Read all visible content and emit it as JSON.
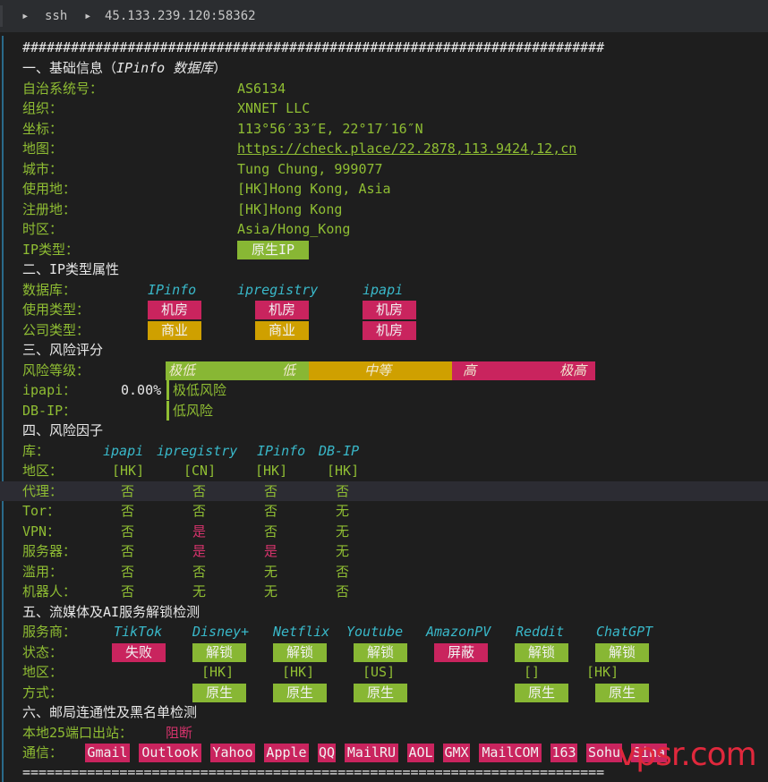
{
  "titlebar": {
    "arrow": "▸",
    "tab": "ssh",
    "host": "45.133.239.120:58362"
  },
  "hashline": "########################################################################",
  "s1": {
    "title": "一、基础信息（",
    "title_italic": "IPinfo 数据库",
    "title_end": "）",
    "rows": [
      {
        "label": "自治系统号：",
        "value": "AS6134"
      },
      {
        "label": "组织：",
        "value": "XNNET LLC"
      },
      {
        "label": "坐标：",
        "value": "113°56′33″E, 22°17′16″N"
      },
      {
        "label": "地图：",
        "value": "https://check.place/22.2878,113.9424,12,cn"
      },
      {
        "label": "城市：",
        "value": "Tung Chung, 999077"
      },
      {
        "label": "使用地：",
        "value": "[HK]Hong Kong, Asia"
      },
      {
        "label": "注册地：",
        "value": "[HK]Hong Kong"
      },
      {
        "label": "时区：",
        "value": "Asia/Hong_Kong"
      },
      {
        "label": "IP类型：",
        "value": "原生IP"
      }
    ]
  },
  "s2": {
    "title": "二、IP类型属性",
    "db_label": "数据库：",
    "dbs": [
      "IPinfo",
      "ipregistry",
      "ipapi"
    ],
    "use_label": "使用类型：",
    "use": [
      "机房",
      "机房",
      "机房"
    ],
    "company_label": "公司类型：",
    "company": [
      "商业",
      "商业",
      "机房"
    ]
  },
  "s3": {
    "title": "三、风险评分",
    "level_label": "风险等级：",
    "scale": [
      "极低",
      "低",
      "中等",
      "高",
      "极高"
    ],
    "ipapi_label": "ipapi：",
    "ipapi_value": "0.00%",
    "ipapi_text": "极低风险",
    "dbip_label": "DB-IP：",
    "dbip_text": "低风险"
  },
  "s4": {
    "title": "四、风险因子",
    "lib_label": "库：",
    "dbs": [
      "ipapi",
      "ipregistry",
      "IPinfo",
      "DB-IP"
    ],
    "rows": [
      {
        "label": "地区：",
        "values": [
          "[HK]",
          "[CN]",
          "[HK]",
          "[HK]"
        ]
      },
      {
        "label": "代理：",
        "values": [
          "否",
          "否",
          "否",
          "否"
        ]
      },
      {
        "label": "Tor：",
        "values": [
          "否",
          "否",
          "否",
          "无"
        ]
      },
      {
        "label": "VPN：",
        "values": [
          "否",
          "是",
          "否",
          "无"
        ]
      },
      {
        "label": "服务器：",
        "values": [
          "否",
          "是",
          "是",
          "无"
        ]
      },
      {
        "label": "滥用：",
        "values": [
          "否",
          "否",
          "无",
          "否"
        ]
      },
      {
        "label": "机器人：",
        "values": [
          "否",
          "无",
          "无",
          "否"
        ]
      }
    ]
  },
  "s5": {
    "title": "五、流媒体及AI服务解锁检测",
    "svc_label": "服务商：",
    "services": [
      "TikTok",
      "Disney+",
      "Netflix",
      "Youtube",
      "AmazonPV",
      "Reddit",
      "ChatGPT"
    ],
    "status_label": "状态：",
    "status": [
      "失败",
      "解锁",
      "解锁",
      "解锁",
      "屏蔽",
      "解锁",
      "解锁"
    ],
    "region_label": "地区：",
    "region": [
      "",
      "[HK]",
      "[HK]",
      "[US]",
      "",
      "[]",
      "[HK]"
    ],
    "method_label": "方式：",
    "method": [
      "",
      "原生",
      "原生",
      "原生",
      "",
      "原生",
      "原生"
    ]
  },
  "s6": {
    "title": "六、邮局连通性及黑名单检测",
    "port_label": "本地25端口出站：",
    "port_value": "阻断",
    "comm_label": "通信：",
    "providers": [
      "Gmail",
      "Outlook",
      "Yahoo",
      "Apple",
      "QQ",
      "MailRU",
      "AOL",
      "GMX",
      "MailCOM",
      "163",
      "Sohu",
      "Sina"
    ]
  },
  "eqline": "========================================================================",
  "watermark": "vpsr.com",
  "colors": {
    "green": "#88b734",
    "pink": "#c9245e",
    "yellow": "#cfa000",
    "cyan": "#39b8c9",
    "bg": "#1e1e1e"
  }
}
